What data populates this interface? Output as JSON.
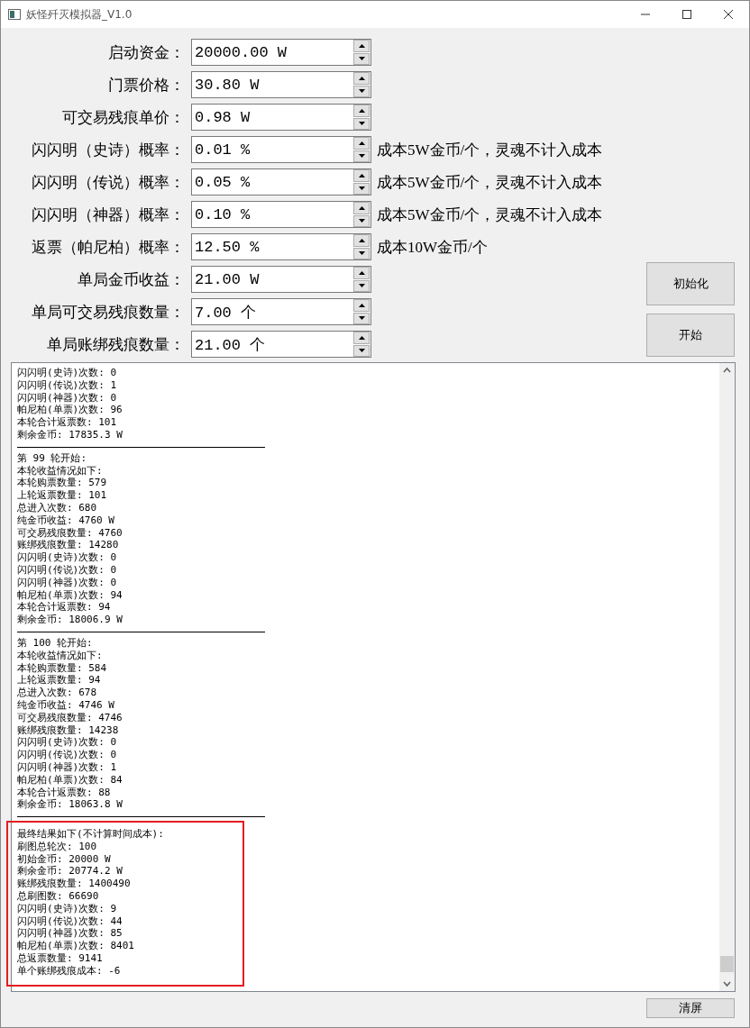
{
  "window": {
    "title": "妖怪歼灭模拟器_V1.0"
  },
  "form": {
    "rows": [
      {
        "label": "启动资金：",
        "value": "20000.00 W"
      },
      {
        "label": "门票价格：",
        "value": "30.80 W"
      },
      {
        "label": "可交易残痕单价：",
        "value": "0.98 W"
      },
      {
        "label": "闪闪明（史诗）概率：",
        "value": "0.01 %",
        "note": "成本5W金币/个，灵魂不计入成本"
      },
      {
        "label": "闪闪明（传说）概率：",
        "value": "0.05 %",
        "note": "成本5W金币/个，灵魂不计入成本"
      },
      {
        "label": "闪闪明（神器）概率：",
        "value": "0.10 %",
        "note": "成本5W金币/个，灵魂不计入成本"
      },
      {
        "label": "返票（帕尼柏）概率：",
        "value": "12.50 %",
        "note": "成本10W金币/个"
      },
      {
        "label": "单局金币收益：",
        "value": "21.00 W"
      },
      {
        "label": "单局可交易残痕数量：",
        "value": "7.00 个"
      },
      {
        "label": "单局账绑残痕数量：",
        "value": "21.00 个"
      }
    ]
  },
  "actions": [
    {
      "label": "初始化"
    },
    {
      "label": "开始"
    }
  ],
  "log": {
    "blocks": [
      {
        "highlighted": false,
        "lines": [
          "闪闪明(史诗)次数: 0",
          "闪闪明(传说)次数: 1",
          "闪闪明(神器)次数: 0",
          "帕尼柏(单票)次数: 96",
          "本轮合计返票数: 101",
          "剩余金币: 17835.3 W"
        ]
      },
      {
        "highlighted": false,
        "lines": [
          "第 99 轮开始:",
          "本轮收益情况如下:",
          "本轮购票数量: 579",
          "上轮返票数量: 101",
          "总进入次数: 680",
          "纯金币收益: 4760 W",
          "可交易残痕数量: 4760",
          "账绑残痕数量: 14280",
          "闪闪明(史诗)次数: 0",
          "闪闪明(传说)次数: 0",
          "闪闪明(神器)次数: 0",
          "帕尼柏(单票)次数: 94",
          "本轮合计返票数: 94",
          "剩余金币: 18006.9 W"
        ]
      },
      {
        "highlighted": false,
        "lines": [
          "第 100 轮开始:",
          "本轮收益情况如下:",
          "本轮购票数量: 584",
          "上轮返票数量: 94",
          "总进入次数: 678",
          "纯金币收益: 4746 W",
          "可交易残痕数量: 4746",
          "账绑残痕数量: 14238",
          "闪闪明(史诗)次数: 0",
          "闪闪明(传说)次数: 0",
          "闪闪明(神器)次数: 1",
          "帕尼柏(单票)次数: 84",
          "本轮合计返票数: 88",
          "剩余金币: 18063.8 W"
        ]
      },
      {
        "highlighted": true,
        "lines": [
          "最终结果如下(不计算时间成本):",
          "刷图总轮次: 100",
          "初始金币: 20000 W",
          "剩余金币: 20774.2 W",
          "账绑残痕数量: 1400490",
          "总刷图数: 66690",
          "闪闪明(史诗)次数: 9",
          "闪闪明(传说)次数: 44",
          "闪闪明(神器)次数: 85",
          "帕尼柏(单票)次数: 8401",
          "总返票数量: 9141",
          "单个账绑残痕成本: -6"
        ]
      }
    ]
  },
  "clear_button": {
    "label": "清屏"
  }
}
